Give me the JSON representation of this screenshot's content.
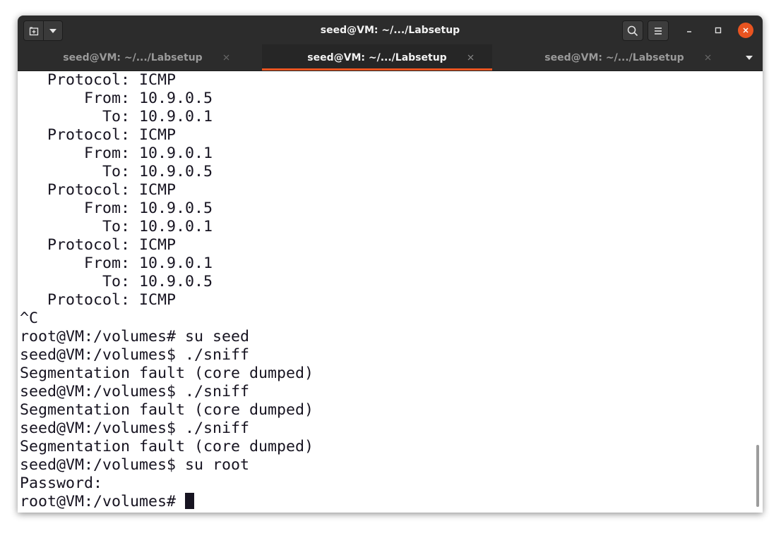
{
  "window": {
    "title": "seed@VM: ~/.../Labsetup"
  },
  "titlebar": {
    "new_tab_icon": "new-tab-icon",
    "tab_menu_icon": "chevron-down-icon",
    "search_icon": "search-icon",
    "menu_icon": "hamburger-menu-icon",
    "minimize_glyph": "–",
    "maximize_glyph": "☐",
    "close_glyph": "✕",
    "accent_color": "#e95420"
  },
  "tabs": [
    {
      "label": "seed@VM: ~/.../Labsetup",
      "active": false,
      "close_glyph": "×"
    },
    {
      "label": "seed@VM: ~/.../Labsetup",
      "active": true,
      "close_glyph": "×"
    },
    {
      "label": "seed@VM: ~/.../Labsetup",
      "active": false,
      "close_glyph": "×"
    }
  ],
  "terminal": {
    "lines": [
      "   Protocol: ICMP",
      "       From: 10.9.0.5",
      "         To: 10.9.0.1",
      "   Protocol: ICMP",
      "       From: 10.9.0.1",
      "         To: 10.9.0.5",
      "   Protocol: ICMP",
      "       From: 10.9.0.5",
      "         To: 10.9.0.1",
      "   Protocol: ICMP",
      "       From: 10.9.0.1",
      "         To: 10.9.0.5",
      "   Protocol: ICMP",
      "^C",
      "root@VM:/volumes# su seed",
      "seed@VM:/volumes$ ./sniff",
      "Segmentation fault (core dumped)",
      "seed@VM:/volumes$ ./sniff",
      "Segmentation fault (core dumped)",
      "seed@VM:/volumes$ ./sniff",
      "Segmentation fault (core dumped)",
      "seed@VM:/volumes$ su root",
      "Password: "
    ],
    "prompt_line": "root@VM:/volumes# "
  }
}
